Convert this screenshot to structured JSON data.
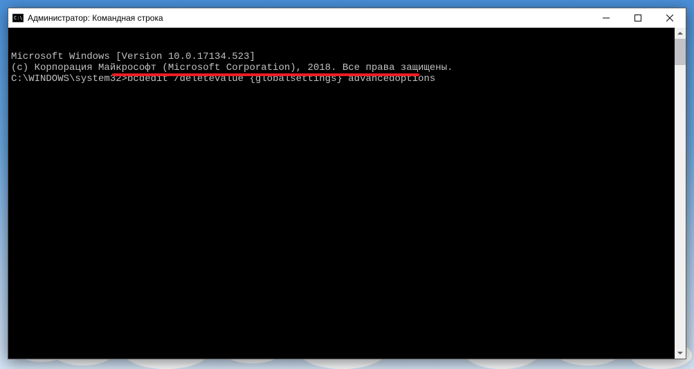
{
  "window": {
    "title": "Администратор: Командная строка"
  },
  "terminal": {
    "line1": "Microsoft Windows [Version 10.0.17134.523]",
    "line2": "(c) Корпорация Майкрософт (Microsoft Corporation), 2018. Все права защищены.",
    "line3": "",
    "prompt": "C:\\WINDOWS\\system32>",
    "command": "bcdedit /deletevalue {globalsettings} advancedoptions"
  },
  "annotation": {
    "underline_color": "#ed1c24"
  }
}
